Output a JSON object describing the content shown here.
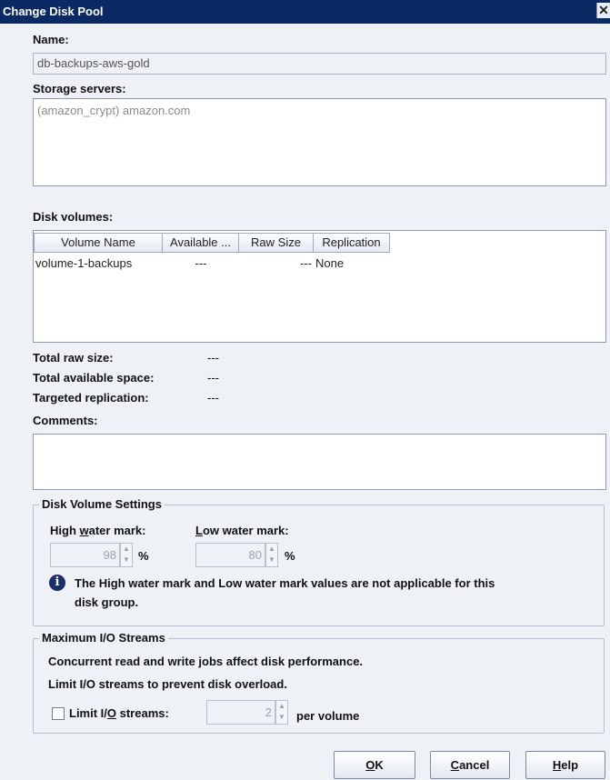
{
  "window": {
    "title": "Change Disk Pool",
    "close_glyph": "✕"
  },
  "name": {
    "label": "Name:",
    "value": "db-backups-aws-gold"
  },
  "storage_servers": {
    "label": "Storage servers:",
    "items": [
      "(amazon_crypt) amazon.com"
    ]
  },
  "disk_volumes": {
    "label": "Disk volumes:",
    "columns": [
      "Volume Name",
      "Available ...",
      "Raw Size",
      "Replication"
    ],
    "rows": [
      {
        "volume_name": "volume-1-backups",
        "available": "---",
        "raw_size": "---",
        "replication": "None"
      }
    ]
  },
  "summary": {
    "total_raw_size": {
      "label": "Total raw size:",
      "value": "---"
    },
    "total_available": {
      "label": "Total available space:",
      "value": "---"
    },
    "targeted_replication": {
      "label": "Targeted replication:",
      "value": "---"
    }
  },
  "comments": {
    "label": "Comments:",
    "value": ""
  },
  "disk_volume_settings": {
    "title": "Disk Volume Settings",
    "high_water": {
      "label_pre": "High ",
      "label_mnemonic": "w",
      "label_post": "ater mark:",
      "value": "98",
      "unit": "%"
    },
    "low_water": {
      "label_pre": "",
      "label_mnemonic": "L",
      "label_post": "ow water mark:",
      "value": "80",
      "unit": "%"
    },
    "info_line1": "The High water mark and Low water mark values are not applicable for this",
    "info_line2": "disk group."
  },
  "max_io": {
    "title": "Maximum I/O Streams",
    "line1": "Concurrent read and write jobs affect disk performance.",
    "line2": "Limit I/O streams to prevent disk overload.",
    "limit_label_pre": "Limit I/",
    "limit_label_mnemonic": "O",
    "limit_label_post": " streams:",
    "limit_checked": false,
    "limit_value": "2",
    "limit_unit": "per volume"
  },
  "buttons": {
    "ok": {
      "mnemonic": "O",
      "rest": "K"
    },
    "cancel": {
      "mnemonic": "C",
      "rest": "ancel"
    },
    "help": {
      "mnemonic": "H",
      "rest": "elp"
    }
  },
  "colors": {
    "titlebar": "#0b2a63",
    "background": "#eef1f6",
    "info_icon": "#1b2f6a"
  }
}
